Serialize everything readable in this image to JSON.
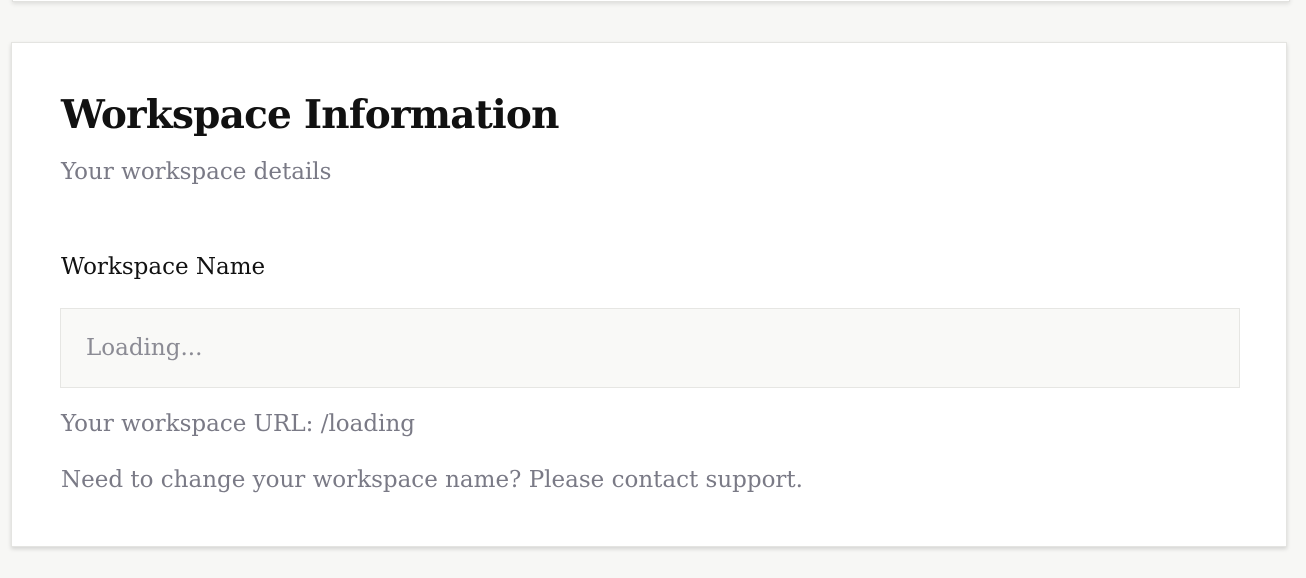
{
  "workspace_info": {
    "title": "Workspace Information",
    "subtitle": "Your workspace details",
    "name_field": {
      "label": "Workspace Name",
      "value": "",
      "placeholder": "Loading..."
    },
    "url_label": "Your workspace URL:",
    "url_value": "/loading",
    "support_note": "Need to change your workspace name? Please contact support."
  },
  "colors": {
    "page_background": "#f7f7f5",
    "card_background": "#ffffff",
    "muted_text": "#7a7a86",
    "heading_text": "#111111",
    "input_background": "#f9f9f7"
  }
}
